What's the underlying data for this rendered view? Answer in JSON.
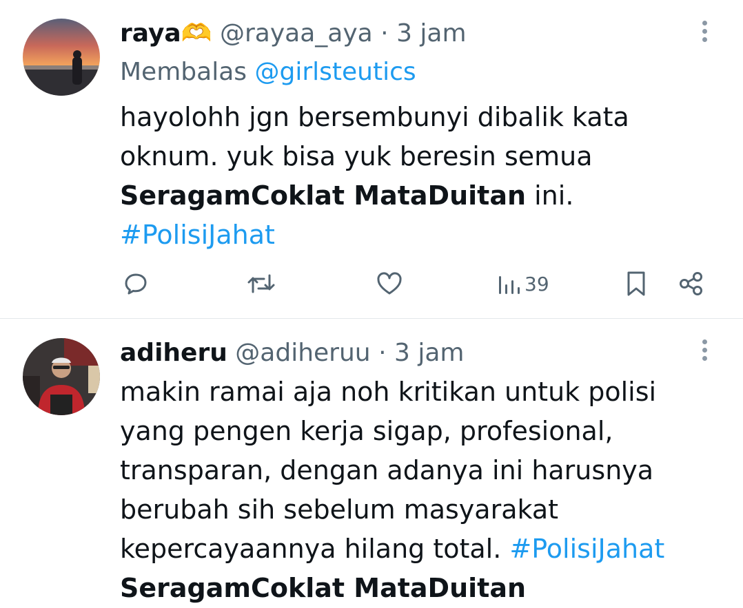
{
  "tweets": [
    {
      "display_name": "raya🫶",
      "handle": "@rayaa_aya",
      "separator": "·",
      "time": "3 jam",
      "reply_prefix": "Membalas",
      "reply_handle": "@girlsteutics",
      "text_part1": "hayolohh jgn bersembunyi dibalik kata oknum. yuk bisa yuk beresin semua ",
      "text_bold": "SeragamCoklat MataDuitan",
      "text_part2": " ini. ",
      "hashtag": "#PolisiJahat",
      "views": "39"
    },
    {
      "display_name": "adiheru",
      "handle": "@adiheruu",
      "separator": "·",
      "time": "3 jam",
      "text_part1": "makin ramai aja noh kritikan untuk polisi yang pengen kerja sigap, profesional, transparan, dengan adanya ini harusnya berubah sih sebelum masyarakat kepercayaannya hilang total. ",
      "hashtag": "#PolisiJahat",
      "text_bold": "SeragamCoklat MataDuitan"
    }
  ],
  "icons": {
    "reply": "speech-bubble-icon",
    "retweet": "retweet-icon",
    "like": "heart-icon",
    "views": "bar-chart-icon",
    "bookmark": "bookmark-icon",
    "share": "share-icon",
    "more": "vertical-ellipsis-icon"
  },
  "colors": {
    "text": "#0f1419",
    "muted": "#536471",
    "link": "#1d9bf0",
    "divider": "#e3e7ea"
  }
}
